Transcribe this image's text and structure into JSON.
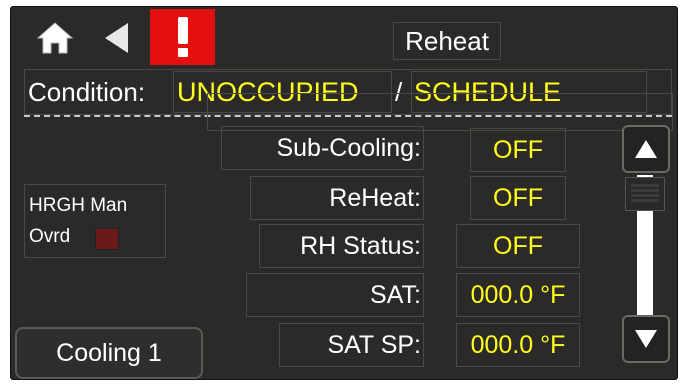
{
  "header": {
    "title": "Reheat",
    "alarm_icon": "exclamation-icon",
    "home_icon": "home-icon",
    "back_icon": "back-arrow-icon"
  },
  "condition": {
    "label": "Condition:",
    "occupancy": "UNOCCUPIED",
    "separator": "/",
    "mode": "SCHEDULE"
  },
  "points": [
    {
      "label": "Sub-Cooling:",
      "value": "OFF"
    },
    {
      "label": "ReHeat:",
      "value": "OFF"
    },
    {
      "label": "RH Status:",
      "value": "OFF"
    },
    {
      "label": "SAT:",
      "value": "000.0 °F"
    },
    {
      "label": "SAT SP:",
      "value": "000.0 °F"
    }
  ],
  "override": {
    "line1": "HRGH Man",
    "line2": "Ovrd"
  },
  "footer": {
    "stage_button": "Cooling 1"
  },
  "colors": {
    "value_text": "#ffff1a",
    "alarm_bg": "#e3100f",
    "override_indicator": "#6b1a1a"
  }
}
